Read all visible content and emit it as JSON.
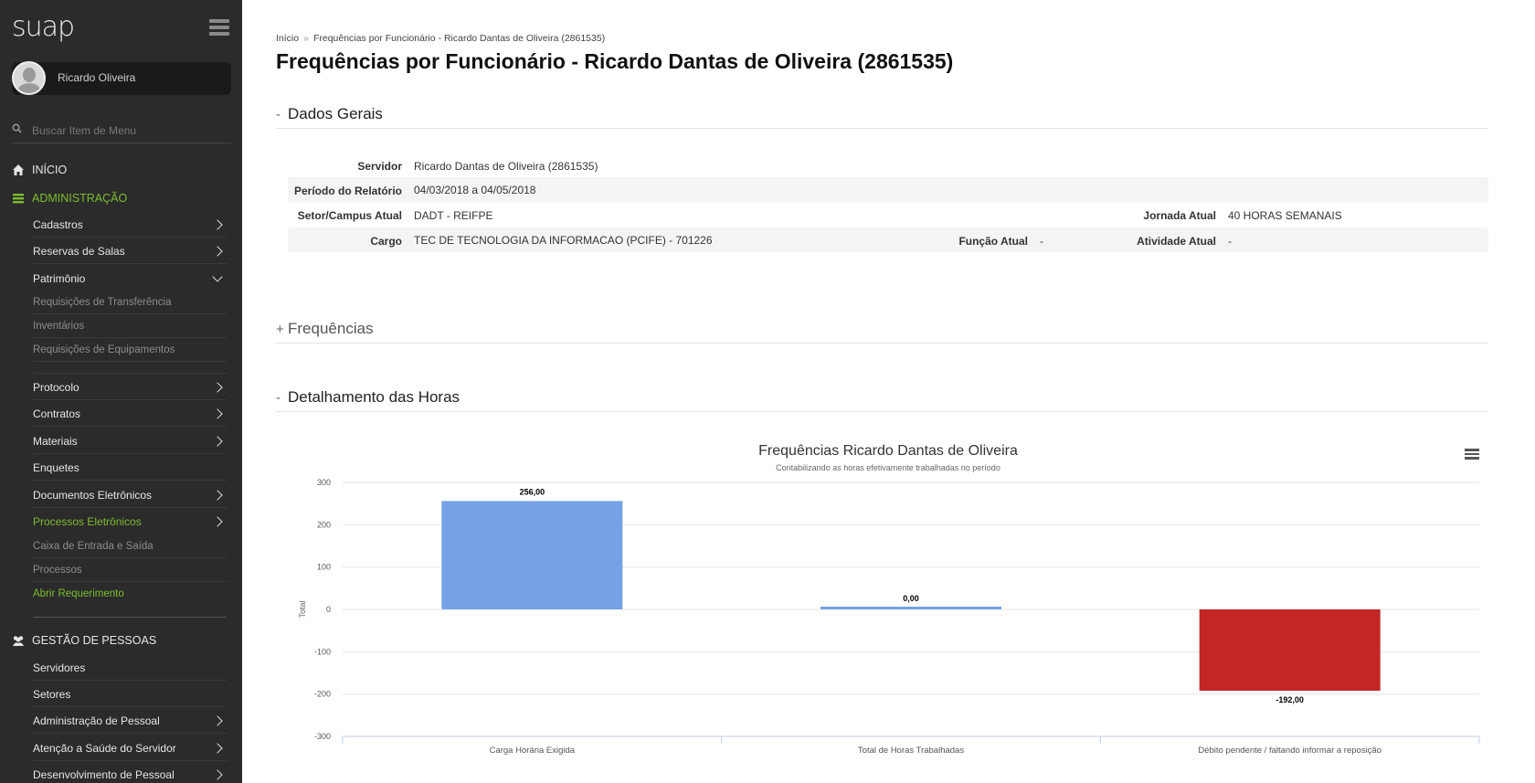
{
  "app": {
    "logo": "suap"
  },
  "user": {
    "name": "Ricardo Oliveira"
  },
  "search": {
    "placeholder": "Buscar Item de Menu"
  },
  "nav": {
    "inicio": "INÍCIO",
    "administracao": "ADMINISTRAÇÃO",
    "gestao": "GESTÃO DE PESSOAS",
    "admin_items": {
      "cadastros": "Cadastros",
      "reservas": "Reservas de Salas",
      "patrimonio": "Patrimônio",
      "patrimonio_sub": [
        "Requisições de Transferência",
        "Inventários",
        "Requisições de Equipamentos"
      ],
      "protocolo": "Protocolo",
      "contratos": "Contratos",
      "materiais": "Materiais",
      "enquetes": "Enquetes",
      "documentos": "Documentos Eletrônicos",
      "processos": "Processos Eletrônicos",
      "processos_sub": [
        "Caixa de Entrada e Saída",
        "Processos",
        "Abrir Requerimento"
      ]
    },
    "gestao_items": {
      "servidores": "Servidores",
      "setores": "Setores",
      "adm_pessoal": "Administração de Pessoal",
      "saude": "Atenção a Saúde do Servidor",
      "desenvolvimento": "Desenvolvimento de Pessoal"
    }
  },
  "breadcrumb": {
    "home": "Início",
    "sep": "»",
    "current": "Frequências por Funcionário - Ricardo Dantas de Oliveira (2861535)"
  },
  "page_title": "Frequências por Funcionário - Ricardo Dantas de Oliveira (2861535)",
  "sections": {
    "dados_gerais": {
      "toggle": "-",
      "title": "Dados Gerais"
    },
    "frequencias": {
      "toggle": "+",
      "title": "Frequências"
    },
    "detalhamento": {
      "toggle": "-",
      "title": "Detalhamento das Horas"
    }
  },
  "dados": {
    "servidor_label": "Servidor",
    "servidor": "Ricardo Dantas de Oliveira (2861535)",
    "periodo_label": "Período do Relatório",
    "periodo": "04/03/2018 a 04/05/2018",
    "setor_label": "Setor/Campus Atual",
    "setor": "DADT - REIFPE",
    "jornada_label": "Jornada Atual",
    "jornada": "40 HORAS SEMANAIS",
    "cargo_label": "Cargo",
    "cargo": "TEC DE TECNOLOGIA DA INFORMACAO (PCIFE) - 701226",
    "funcao_label": "Função Atual",
    "funcao": "-",
    "atividade_label": "Atividade Atual",
    "atividade": "-"
  },
  "chart_data": {
    "type": "bar",
    "title": "Frequências Ricardo Dantas de Oliveira",
    "subtitle": "Contabilizando as horas efetivamente trabalhadas no período",
    "ylabel": "Total",
    "xlabel": "",
    "ylim": [
      -300,
      300
    ],
    "yticks": [
      300,
      200,
      100,
      0,
      -100,
      -200,
      -300
    ],
    "categories": [
      "Carga Horária Exigida",
      "Total de Horas Trabalhadas",
      "Débito pendente / faltando informar a reposição"
    ],
    "values": [
      256,
      0,
      -192
    ],
    "data_labels": [
      "256,00",
      "0,00",
      "-192,00"
    ],
    "colors": [
      "#77a1e5",
      "#77a1e5",
      "#c42525"
    ],
    "grid": true,
    "legend": "none"
  }
}
